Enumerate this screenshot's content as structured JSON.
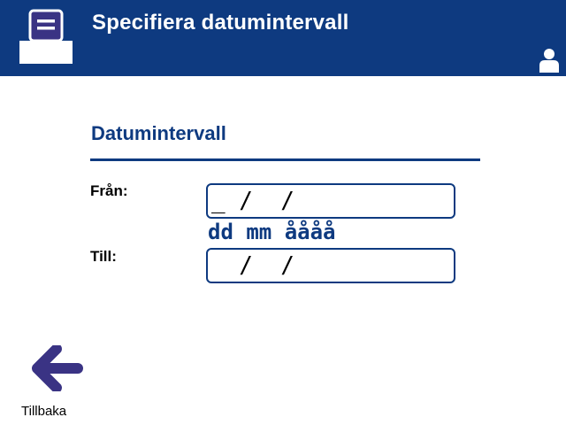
{
  "header": {
    "title": "Specifiera datumintervall",
    "printer_icon": "printer-icon",
    "user_icon": "user-icon",
    "bg_color": "#0e3a80"
  },
  "section": {
    "title": "Datumintervall"
  },
  "fields": {
    "from": {
      "label": "Från:",
      "value": "_ /  /"
    },
    "format_hint": "dd mm åååå",
    "to": {
      "label": "Till:",
      "value": "  /  /"
    }
  },
  "footer": {
    "back_label": "Tillbaka",
    "back_icon": "arrow-left-icon"
  },
  "colors": {
    "accent": "#0e3a80",
    "background": "#ffffff"
  }
}
